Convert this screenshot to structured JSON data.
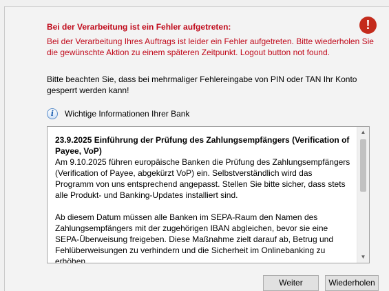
{
  "error": {
    "title": "Bei der Verarbeitung ist ein Fehler aufgetreten:",
    "message": "Bei der Verarbeitung Ihres Auftrags ist leider ein Fehler aufgetreten. Bitte wiederholen Sie die gewünschte Aktion zu einem späteren Zeitpunkt. Logout button not found.",
    "icon": "error-icon",
    "color": "#c0091a"
  },
  "note": "Bitte beachten Sie, dass bei mehrmaliger Fehlereingabe von PIN oder TAN Ihr Konto gesperrt werden kann!",
  "info": {
    "icon": "info-icon",
    "label": "Wichtige Informationen Ihrer Bank"
  },
  "bank_info": {
    "heading": "23.9.2025 Einführung der Prüfung des Zahlungsempfängers (Verification of Payee, VoP)",
    "paragraph1": "Am 9.10.2025 führen europäische Banken die Prüfung des Zahlungsempfängers (Verification of Payee, abgekürzt VoP) ein. Selbstverständlich wird das Programm von uns entsprechend angepasst. Stellen Sie bitte sicher, dass stets alle Produkt- und Banking-Updates installiert sind.",
    "paragraph2": "Ab diesem Datum müssen alle Banken im SEPA-Raum den Namen des Zahlungsempfängers mit der zugehörigen IBAN abgleichen, bevor sie eine SEPA-Überweisung freigeben. Diese Maßnahme zielt darauf ab, Betrug und Fehlüberweisungen zu verhindern und die Sicherheit im Onlinebanking zu erhöhen."
  },
  "buttons": {
    "weiter": "Weiter",
    "wiederholen": "Wiederholen"
  }
}
